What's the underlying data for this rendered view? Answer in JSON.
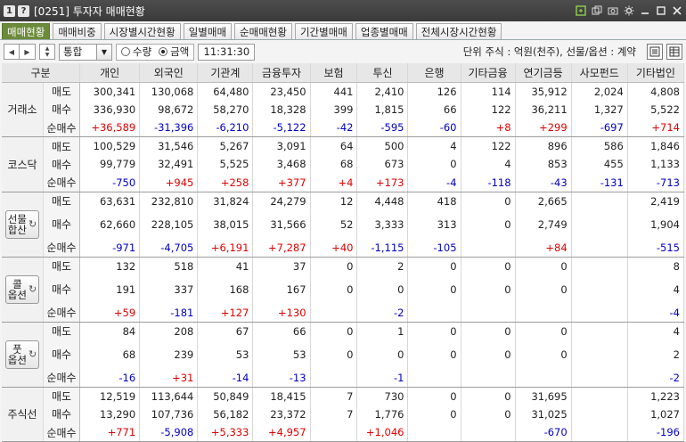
{
  "window": {
    "badge1": "1",
    "badge2": "?",
    "title": "[0251] 투자자 매매현황"
  },
  "tabs": [
    "매매현황",
    "매매비중",
    "시장별시간현황",
    "일별매매",
    "순매매현황",
    "기간별매매",
    "업종별매매",
    "전체시장시간현황"
  ],
  "toolbar": {
    "combo": "통합",
    "radio1": "수량",
    "radio2": "금액",
    "time": "11:31:30",
    "unit": "단위 주식 : 억원(천주), 선물/옵션 : 계약"
  },
  "headers": [
    "구분",
    "개인",
    "외국인",
    "기관계",
    "금융투자",
    "보험",
    "투신",
    "은행",
    "기타금융",
    "연기금등",
    "사모펀드",
    "기타법인"
  ],
  "groups": [
    {
      "name": "거래소",
      "button": false,
      "rows": [
        {
          "label": "매도",
          "type": "plain",
          "values": [
            "300,341",
            "130,068",
            "64,480",
            "23,450",
            "441",
            "2,410",
            "126",
            "114",
            "35,912",
            "2,024",
            "4,808"
          ]
        },
        {
          "label": "매수",
          "type": "plain",
          "values": [
            "336,930",
            "98,672",
            "58,270",
            "18,328",
            "399",
            "1,815",
            "66",
            "122",
            "36,211",
            "1,327",
            "5,522"
          ]
        },
        {
          "label": "순매수",
          "type": "net",
          "values": [
            "+36,589",
            "-31,396",
            "-6,210",
            "-5,122",
            "-42",
            "-595",
            "-60",
            "+8",
            "+299",
            "-697",
            "+714"
          ]
        }
      ]
    },
    {
      "name": "코스닥",
      "button": false,
      "rows": [
        {
          "label": "매도",
          "type": "plain",
          "values": [
            "100,529",
            "31,546",
            "5,267",
            "3,091",
            "64",
            "500",
            "4",
            "122",
            "896",
            "586",
            "1,846"
          ]
        },
        {
          "label": "매수",
          "type": "plain",
          "values": [
            "99,779",
            "32,491",
            "5,525",
            "3,468",
            "68",
            "673",
            "0",
            "4",
            "853",
            "455",
            "1,133"
          ]
        },
        {
          "label": "순매수",
          "type": "net",
          "values": [
            "-750",
            "+945",
            "+258",
            "+377",
            "+4",
            "+173",
            "-4",
            "-118",
            "-43",
            "-131",
            "-713"
          ]
        }
      ]
    },
    {
      "name": "선물합산",
      "line1": "선물",
      "line2": "합산",
      "button": true,
      "rows": [
        {
          "label": "매도",
          "type": "plain",
          "values": [
            "63,631",
            "232,810",
            "31,824",
            "24,279",
            "12",
            "4,448",
            "418",
            "0",
            "2,665",
            "",
            "2,419"
          ]
        },
        {
          "label": "매수",
          "type": "plain",
          "values": [
            "62,660",
            "228,105",
            "38,015",
            "31,566",
            "52",
            "3,333",
            "313",
            "0",
            "2,749",
            "",
            "1,904"
          ]
        },
        {
          "label": "순매수",
          "type": "net",
          "values": [
            "-971",
            "-4,705",
            "+6,191",
            "+7,287",
            "+40",
            "-1,115",
            "-105",
            "",
            "+84",
            "",
            "-515"
          ]
        }
      ]
    },
    {
      "name": "콜옵션",
      "line1": "콜",
      "line2": "옵션",
      "button": true,
      "rows": [
        {
          "label": "매도",
          "type": "plain",
          "values": [
            "132",
            "518",
            "41",
            "37",
            "0",
            "2",
            "0",
            "0",
            "0",
            "",
            "8"
          ]
        },
        {
          "label": "매수",
          "type": "plain",
          "values": [
            "191",
            "337",
            "168",
            "167",
            "0",
            "0",
            "0",
            "0",
            "0",
            "",
            "4"
          ]
        },
        {
          "label": "순매수",
          "type": "net",
          "values": [
            "+59",
            "-181",
            "+127",
            "+130",
            "",
            "-2",
            "",
            "",
            "",
            "",
            "-4"
          ]
        }
      ]
    },
    {
      "name": "풋옵션",
      "line1": "풋",
      "line2": "옵션",
      "button": true,
      "rows": [
        {
          "label": "매도",
          "type": "plain",
          "values": [
            "84",
            "208",
            "67",
            "66",
            "0",
            "1",
            "0",
            "0",
            "0",
            "",
            "4"
          ]
        },
        {
          "label": "매수",
          "type": "plain",
          "values": [
            "68",
            "239",
            "53",
            "53",
            "0",
            "0",
            "0",
            "0",
            "0",
            "",
            "2"
          ]
        },
        {
          "label": "순매수",
          "type": "net",
          "values": [
            "-16",
            "+31",
            "-14",
            "-13",
            "",
            "-1",
            "",
            "",
            "",
            "",
            "-2"
          ]
        }
      ]
    },
    {
      "name": "주식선",
      "button": false,
      "rows": [
        {
          "label": "매도",
          "type": "plain",
          "values": [
            "12,519",
            "113,644",
            "50,849",
            "18,415",
            "7",
            "730",
            "0",
            "0",
            "31,695",
            "",
            "1,223"
          ]
        },
        {
          "label": "매수",
          "type": "plain",
          "values": [
            "13,290",
            "107,736",
            "56,182",
            "23,372",
            "7",
            "1,776",
            "0",
            "0",
            "31,025",
            "",
            "1,027"
          ]
        },
        {
          "label": "순매수",
          "type": "net",
          "values": [
            "+771",
            "-5,908",
            "+5,333",
            "+4,957",
            "",
            "+1,046",
            "",
            "",
            "-670",
            "",
            "-196"
          ]
        }
      ]
    }
  ],
  "colors": {
    "positive": "#e00000",
    "negative": "#0000c8",
    "active_tab": "#6c8b3a",
    "highlight_header": "#f2ef9f"
  }
}
